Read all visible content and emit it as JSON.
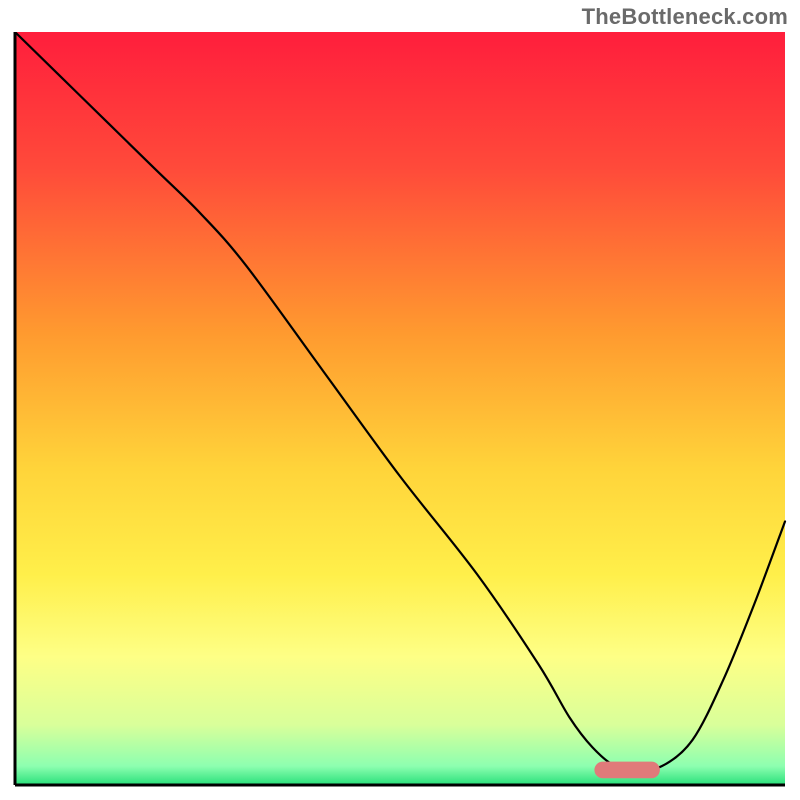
{
  "watermark": "TheBottleneck.com",
  "chart_data": {
    "type": "line",
    "title": "",
    "xlabel": "",
    "ylabel": "",
    "xlim": [
      0,
      100
    ],
    "ylim": [
      0,
      100
    ],
    "grid": false,
    "legend": false,
    "axes_visible": {
      "left": true,
      "bottom": true,
      "right": false,
      "top": false
    },
    "background_gradient": {
      "type": "vertical",
      "stops": [
        {
          "pos": 0.0,
          "color": "#ff1e3c"
        },
        {
          "pos": 0.18,
          "color": "#ff4a3a"
        },
        {
          "pos": 0.4,
          "color": "#ff9a2f"
        },
        {
          "pos": 0.58,
          "color": "#ffd43a"
        },
        {
          "pos": 0.72,
          "color": "#ffef4a"
        },
        {
          "pos": 0.83,
          "color": "#feff86"
        },
        {
          "pos": 0.92,
          "color": "#d9ff9a"
        },
        {
          "pos": 0.975,
          "color": "#8dffb0"
        },
        {
          "pos": 1.0,
          "color": "#29e07a"
        }
      ]
    },
    "series": [
      {
        "name": "curve",
        "color": "#000000",
        "width": 2.2,
        "x": [
          0,
          8,
          18,
          24,
          30,
          40,
          50,
          60,
          68,
          72,
          75,
          78,
          81,
          84,
          88,
          92,
          96,
          100
        ],
        "y": [
          100,
          92,
          82,
          76,
          69,
          55,
          41,
          28,
          16,
          9,
          5,
          2.5,
          2.4,
          2.5,
          6,
          14,
          24,
          35
        ]
      }
    ],
    "marker": {
      "name": "highlight-pill",
      "color": "#e07a7a",
      "x_center": 79.5,
      "y": 2.0,
      "width": 8.5,
      "height": 2.2,
      "rx": 1.1
    }
  }
}
